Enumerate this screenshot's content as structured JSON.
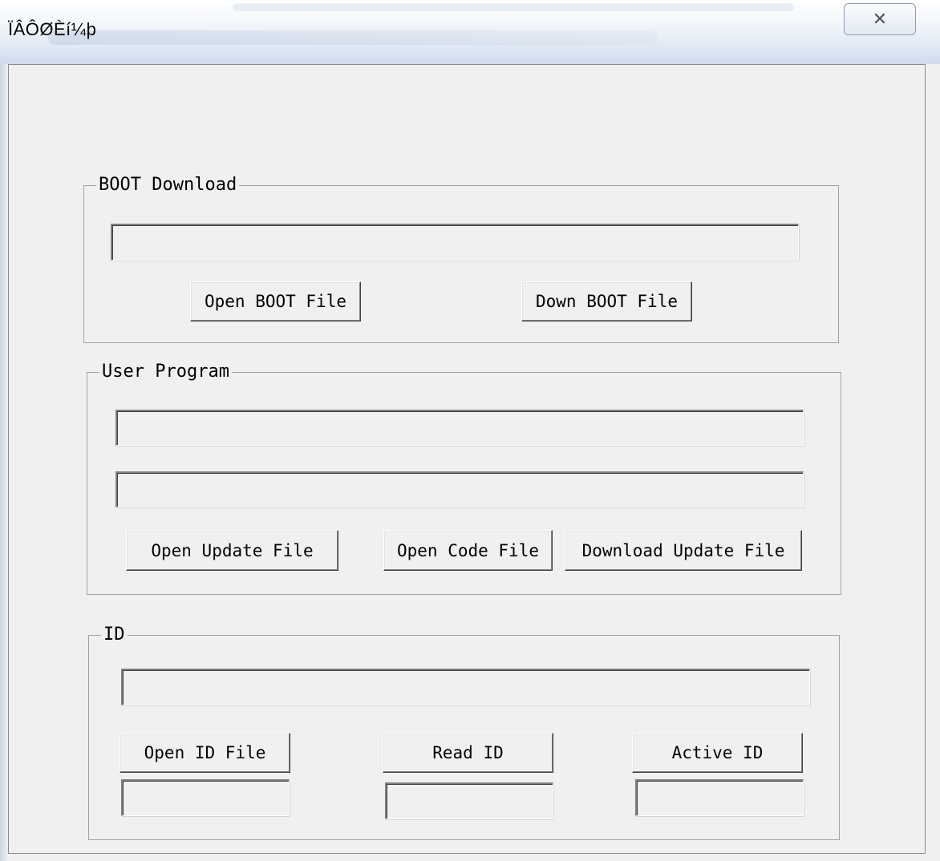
{
  "window": {
    "title": "ÏÂÔØÈí¼þ",
    "close_glyph": "✕"
  },
  "boot_download": {
    "label": "BOOT Download",
    "path_value": "",
    "open_button": "Open BOOT File",
    "down_button": "Down BOOT File"
  },
  "user_program": {
    "label": "User Program",
    "update_path_value": "",
    "code_path_value": "",
    "open_update_button": "Open Update File",
    "open_code_button": "Open Code File",
    "download_update_button": "Download Update File"
  },
  "id_section": {
    "label": "ID",
    "path_value": "",
    "open_id_button": "Open ID File",
    "read_id_button": "Read ID",
    "active_id_button": "Active ID",
    "open_id_result": "",
    "read_id_result": "",
    "active_id_result": ""
  }
}
